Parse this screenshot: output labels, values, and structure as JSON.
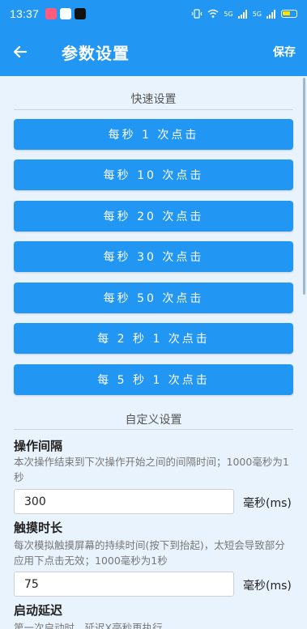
{
  "status_bar": {
    "time": "13:37",
    "network_label_1": "5G",
    "network_label_2": "5G"
  },
  "app_bar": {
    "title": "参数设置",
    "save_label": "保存",
    "back_icon": "arrow-left-icon"
  },
  "quick_settings": {
    "header": "快速设置",
    "buttons": [
      "每秒 1 次点击",
      "每秒 10 次点击",
      "每秒 20 次点击",
      "每秒 30 次点击",
      "每秒 50 次点击",
      "每 2 秒 1 次点击",
      "每 5 秒 1 次点击"
    ]
  },
  "custom_settings": {
    "header": "自定义设置",
    "interval": {
      "title": "操作间隔",
      "desc": "本次操作结束到下次操作开始之间的间隔时间；1000毫秒为1秒",
      "value": "300",
      "unit": "毫秒(ms)"
    },
    "touch_duration": {
      "title": "触摸时长",
      "desc": "每次模拟触摸屏幕的持续时间(按下到抬起)，太短会导致部分应用下点击无效；1000毫秒为1秒",
      "value": "75",
      "unit": "毫秒(ms)"
    },
    "start_delay": {
      "title": "启动延迟",
      "desc": "第一次启动时，延迟X毫秒再执行"
    }
  },
  "colors": {
    "primary": "#2196f3",
    "background": "#e9f3fd",
    "battery": "#ffe400"
  }
}
